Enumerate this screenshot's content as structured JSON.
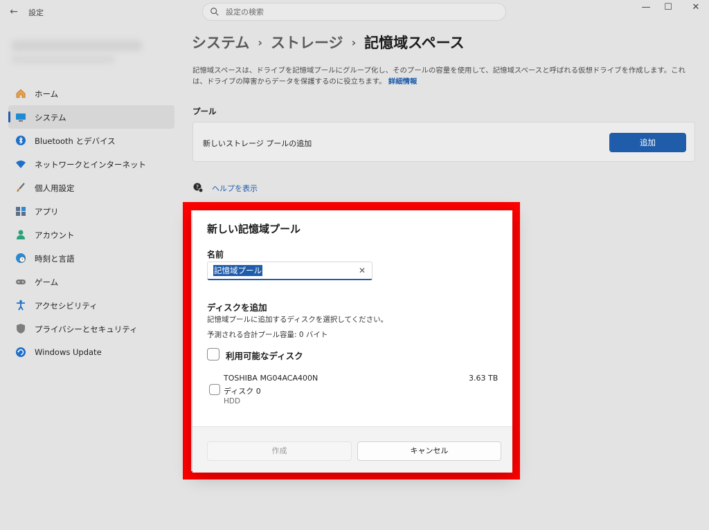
{
  "window": {
    "back_glyph": "←",
    "app_title": "設定",
    "minimize_glyph": "—",
    "maximize_glyph": "☐",
    "close_glyph": "✕"
  },
  "search": {
    "placeholder": "設定の検索",
    "icon": "search-icon"
  },
  "sidebar": {
    "items": [
      {
        "label": "ホーム",
        "icon": "home-icon",
        "active": false
      },
      {
        "label": "システム",
        "icon": "monitor-icon",
        "active": true
      },
      {
        "label": "Bluetooth とデバイス",
        "icon": "bluetooth-icon",
        "active": false
      },
      {
        "label": "ネットワークとインターネット",
        "icon": "wifi-icon",
        "active": false
      },
      {
        "label": "個人用設定",
        "icon": "brush-icon",
        "active": false
      },
      {
        "label": "アプリ",
        "icon": "apps-icon",
        "active": false
      },
      {
        "label": "アカウント",
        "icon": "account-icon",
        "active": false
      },
      {
        "label": "時刻と言語",
        "icon": "globe-clock-icon",
        "active": false
      },
      {
        "label": "ゲーム",
        "icon": "gamepad-icon",
        "active": false
      },
      {
        "label": "アクセシビリティ",
        "icon": "accessibility-icon",
        "active": false
      },
      {
        "label": "プライバシーとセキュリティ",
        "icon": "shield-icon",
        "active": false
      },
      {
        "label": "Windows Update",
        "icon": "update-icon",
        "active": false
      }
    ]
  },
  "main": {
    "breadcrumb": [
      "システム",
      "ストレージ",
      "記憶域スペース"
    ],
    "breadcrumb_sep": "›",
    "description": "記憶域スペースは、ドライブを記憶域プールにグループ化し、そのプールの容量を使用して、記憶域スペースと呼ばれる仮想ドライブを作成します。これは、ドライブの障害からデータを保護するのに役立ちます。",
    "more_info_link": "詳細情報",
    "pool_section_title": "プール",
    "pool_card_label": "新しいストレージ プールの追加",
    "add_button": "追加",
    "help_link": "ヘルプを表示"
  },
  "dialog": {
    "title": "新しい記憶域プール",
    "name_label": "名前",
    "name_value": "記憶域プール",
    "clear_glyph": "✕",
    "add_disk_title": "ディスクを追加",
    "add_disk_desc": "記憶域プールに追加するディスクを選択してください。",
    "capacity_text": "予測される合計プール容量: 0 バイト",
    "available_disks_label": "利用可能なディスク",
    "disks": [
      {
        "name": "TOSHIBA MG04ACA400N",
        "number": "ディスク 0",
        "type": "HDD",
        "size": "3.63 TB",
        "checked": false
      }
    ],
    "create_button": "作成",
    "cancel_button": "キャンセル"
  },
  "colors": {
    "accent": "#1f5dab",
    "highlight_border": "#ff0000",
    "background": "#e3e3e3"
  }
}
